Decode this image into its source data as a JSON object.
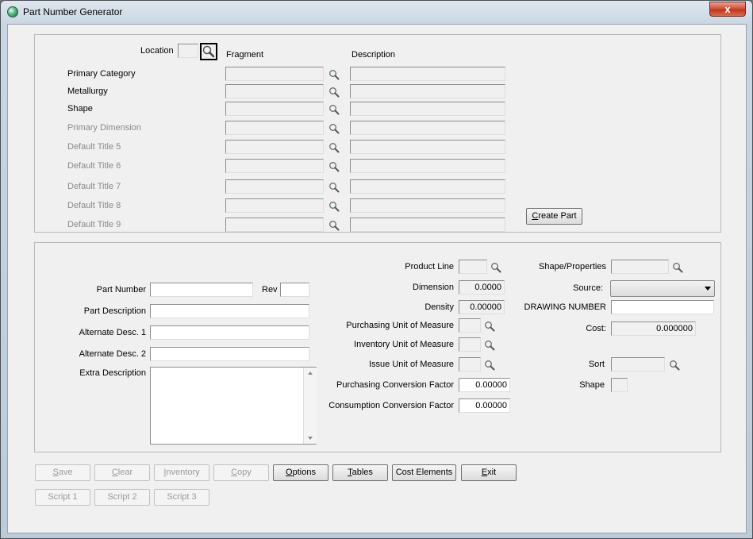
{
  "window": {
    "title": "Part Number Generator",
    "close_glyph": "x",
    "app_icon": "globe-icon"
  },
  "top": {
    "location_label": "Location",
    "location_value": "",
    "fragment_header": "Fragment",
    "description_header": "Description",
    "rows": [
      {
        "label": "Primary Category",
        "enabled": true,
        "fragment": "",
        "description": ""
      },
      {
        "label": "Metallurgy",
        "enabled": true,
        "fragment": "",
        "description": ""
      },
      {
        "label": "Shape",
        "enabled": true,
        "fragment": "",
        "description": ""
      },
      {
        "label": "Primary Dimension",
        "enabled": false,
        "fragment": "",
        "description": ""
      },
      {
        "label": "Default Title 5",
        "enabled": false,
        "fragment": "",
        "description": ""
      },
      {
        "label": "Default Title 6",
        "enabled": false,
        "fragment": "",
        "description": ""
      },
      {
        "label": "Default Title 7",
        "enabled": false,
        "fragment": "",
        "description": ""
      },
      {
        "label": "Default Title 8",
        "enabled": false,
        "fragment": "",
        "description": ""
      },
      {
        "label": "Default Title 9",
        "enabled": false,
        "fragment": "",
        "description": ""
      }
    ],
    "create_part_label": "Create Part",
    "create_part_mnemonic": "C",
    "create_part_rest": "reate Part"
  },
  "bottom": {
    "part_number_label": "Part Number",
    "part_number_value": "",
    "rev_label": "Rev",
    "rev_value": "",
    "part_description_label": "Part Description",
    "part_description_value": "",
    "alt_desc1_label": "Alternate Desc. 1",
    "alt_desc1_value": "",
    "alt_desc2_label": "Alternate Desc. 2",
    "alt_desc2_value": "",
    "extra_description_label": "Extra Description",
    "extra_description_value": "",
    "product_line_label": "Product Line",
    "product_line_value": "",
    "dimension_label": "Dimension",
    "dimension_value": "0.0000",
    "density_label": "Density",
    "density_value": "0.00000",
    "purchasing_uom_label": "Purchasing Unit of Measure",
    "purchasing_uom_value": "",
    "inventory_uom_label": "Inventory Unit of Measure",
    "inventory_uom_value": "",
    "issue_uom_label": "Issue Unit of Measure",
    "issue_uom_value": "",
    "purchasing_cf_label": "Purchasing Conversion Factor",
    "purchasing_cf_value": "0.00000",
    "consumption_cf_label": "Consumption Conversion Factor",
    "consumption_cf_value": "0.00000",
    "shape_properties_label": "Shape/Properties",
    "shape_properties_value": "",
    "source_label": "Source:",
    "source_value": "",
    "drawing_number_label": "DRAWING NUMBER",
    "drawing_number_value": "",
    "cost_label": "Cost:",
    "cost_value": "0.000000",
    "sort_label": "Sort",
    "sort_value": "",
    "shape_label": "Shape",
    "shape_value": ""
  },
  "buttons": {
    "save": {
      "mn": "S",
      "rest": "ave"
    },
    "clear": {
      "mn": "C",
      "rest": "lear"
    },
    "inventory": {
      "mn": "I",
      "rest": "nventory"
    },
    "copy": {
      "mn": "C",
      "rest": "opy"
    },
    "options": {
      "mn": "O",
      "rest": "ptions"
    },
    "tables": {
      "mn": "T",
      "rest": "ables"
    },
    "cost_elements": "Cost Elements",
    "exit": {
      "mn": "E",
      "rest": "xit"
    },
    "script1": "Script 1",
    "script2": "Script 2",
    "script3": "Script 3"
  }
}
